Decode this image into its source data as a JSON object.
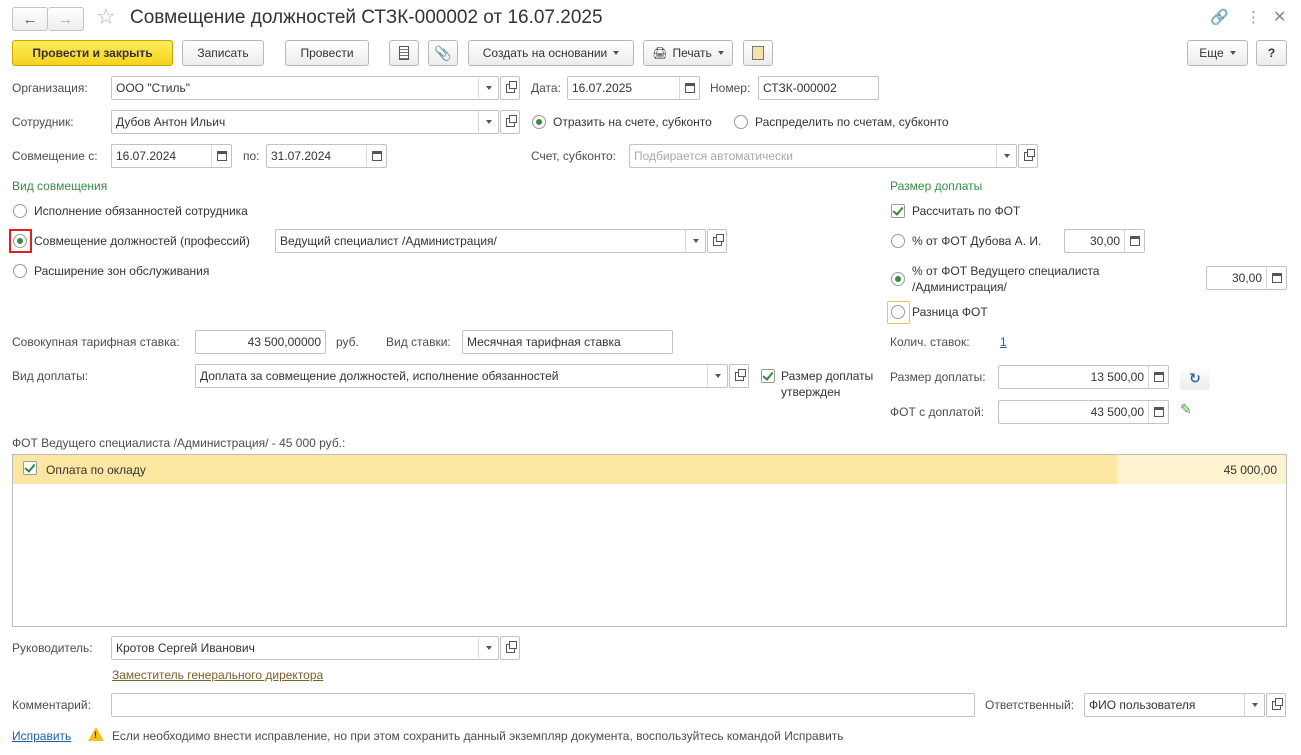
{
  "window": {
    "title": "Совмещение должностей СТЗК-000002 от 16.07.2025"
  },
  "toolbar": {
    "post_close": "Провести и закрыть",
    "save": "Записать",
    "post": "Провести",
    "create_based": "Создать на основании",
    "print": "Печать",
    "more": "Еще",
    "help": "?"
  },
  "form": {
    "org_label": "Организация:",
    "org_value": "ООО \"Стиль\"",
    "date_label": "Дата:",
    "date_value": "16.07.2025",
    "number_label": "Номер:",
    "number_value": "СТЗК-000002",
    "employee_label": "Сотрудник:",
    "employee_value": "Дубов Антон Ильич",
    "reflect_account": "Отразить на счете, субконто",
    "distribute_accounts": "Распределить по счетам, субконто",
    "combo_from_label": "Совмещение с:",
    "combo_from": "16.07.2024",
    "combo_to_label": "по:",
    "combo_to": "31.07.2024",
    "account_label": "Счет, субконто:",
    "account_placeholder": "Подбирается автоматически"
  },
  "combination": {
    "header": "Вид совмещения",
    "opt1": "Исполнение обязанностей сотрудника",
    "opt2": "Совмещение должностей (профессий)",
    "opt2_position": "Ведущий специалист /Администрация/",
    "opt3": "Расширение зон обслуживания"
  },
  "payment_size": {
    "header": "Размер доплаты",
    "calc_by_fot": "Рассчитать по ФОТ",
    "pct_employee": "% от ФОТ Дубова А. И.",
    "pct_employee_value": "30,00",
    "pct_position_line1": "% от ФОТ Ведущего специалиста",
    "pct_position_line2": "/Администрация/",
    "pct_position_value": "30,00",
    "fot_diff": "Разница ФОТ",
    "rate_count_label": "Колич. ставок:",
    "rate_count": "1",
    "amount_label": "Размер доплаты:",
    "amount_value": "13 500,00",
    "fot_with_label": "ФОТ с доплатой:",
    "fot_with_value": "43 500,00"
  },
  "rates": {
    "total_rate_label": "Совокупная тарифная ставка:",
    "total_rate_value": "43 500,00000",
    "currency": "руб.",
    "rate_type_label": "Вид ставки:",
    "rate_type_value": "Месячная тарифная ставка",
    "payment_type_label": "Вид доплаты:",
    "payment_type_value": "Доплата за совмещение должностей, исполнение обязанностей",
    "approved_line1": "Размер доплаты",
    "approved_line2": "утвержден"
  },
  "fot_table": {
    "caption": "ФОТ Ведущего специалиста /Администрация/ - 45 000 руб.:",
    "rows": [
      {
        "name": "Оплата по окладу",
        "amount": "45 000,00"
      }
    ]
  },
  "footer": {
    "manager_label": "Руководитель:",
    "manager_value": "Кротов Сергей Иванович",
    "manager_position": "Заместитель генерального директора",
    "comment_label": "Комментарий:",
    "responsible_label": "Ответственный:",
    "responsible_value": "ФИО пользователя",
    "fix_link": "Исправить",
    "fix_hint": "Если необходимо внести исправление, но при этом сохранить данный экземпляр документа, воспользуйтесь командой Исправить"
  },
  "colors": {
    "accent_green": "#3a8a46",
    "primary_yellow": "#f5d21c",
    "row_highlight": "#fbe7a1",
    "focus_red": "#e02020"
  }
}
